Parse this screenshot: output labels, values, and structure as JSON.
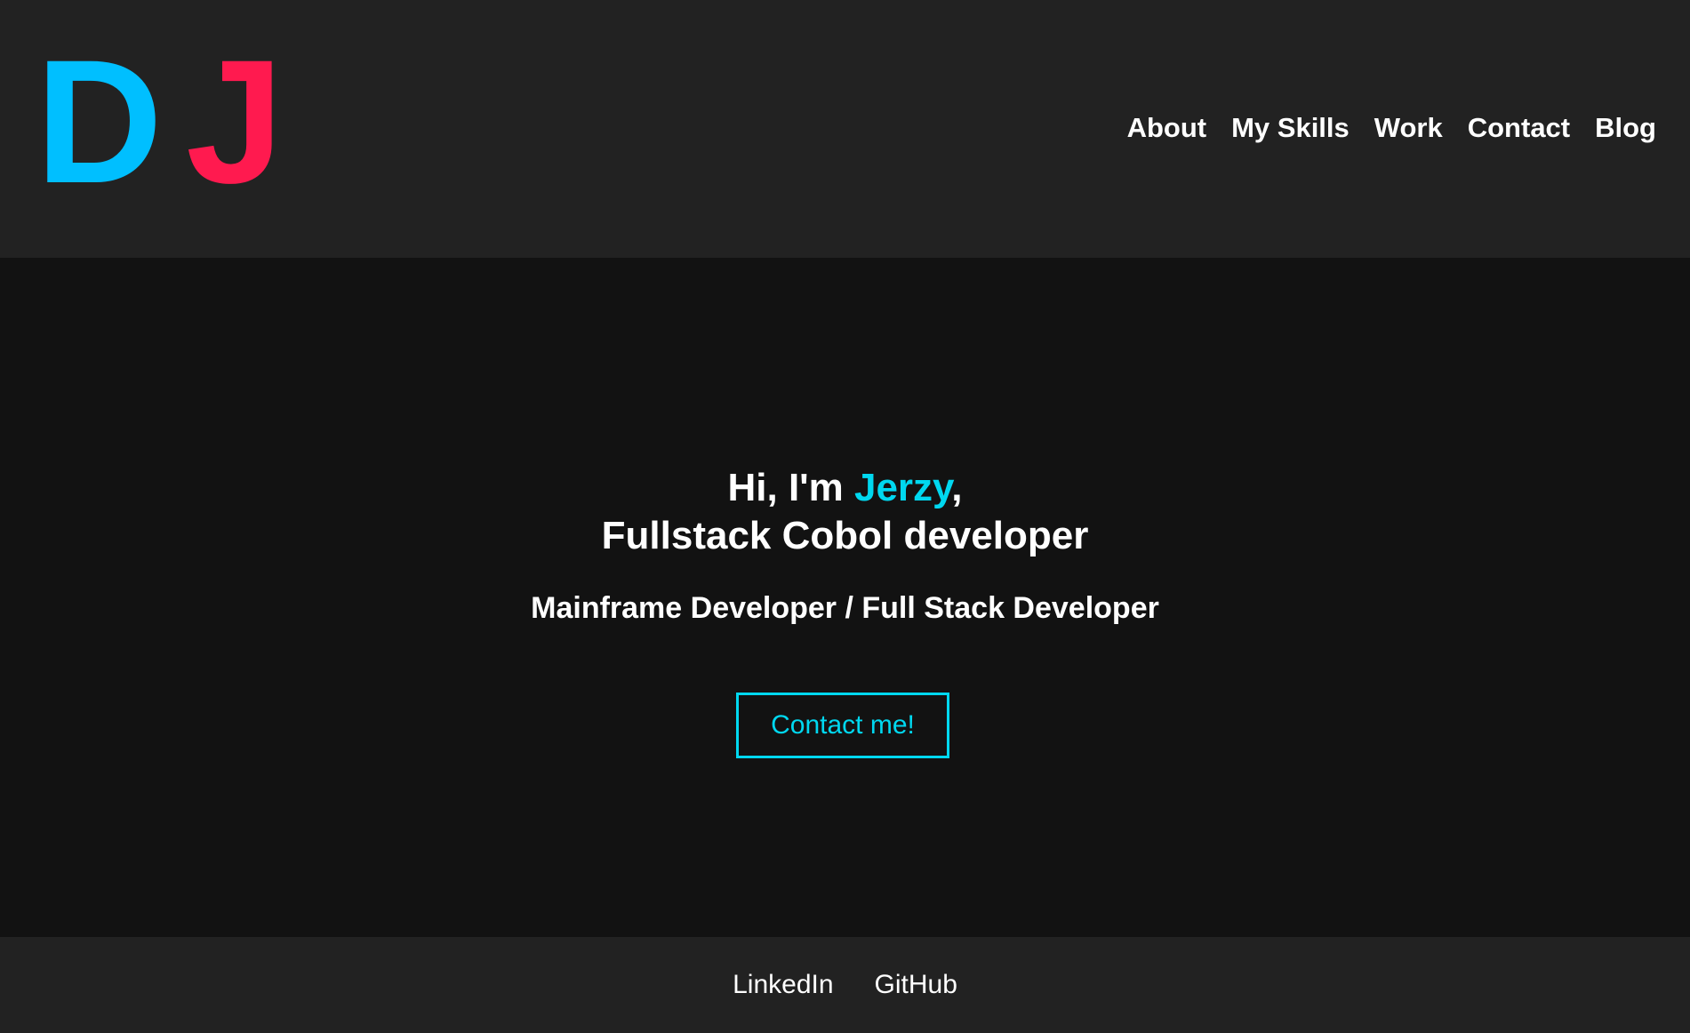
{
  "logo": {
    "first_letter": "D",
    "second_letter": "J"
  },
  "nav": {
    "items": [
      {
        "label": "About"
      },
      {
        "label": "My Skills"
      },
      {
        "label": "Work"
      },
      {
        "label": "Contact"
      },
      {
        "label": "Blog"
      }
    ]
  },
  "hero": {
    "greeting_prefix": "Hi, I'm ",
    "name": "Jerzy",
    "greeting_suffix": ",",
    "role": "Fullstack Cobol developer",
    "subtitle": "Mainframe Developer / Full Stack Developer",
    "cta_label": "Contact me!"
  },
  "footer": {
    "links": [
      {
        "label": "LinkedIn"
      },
      {
        "label": "GitHub"
      }
    ]
  },
  "colors": {
    "header_bg": "#222222",
    "page_bg": "#121212",
    "logo_d": "#00bfff",
    "logo_j": "#ff1a4f",
    "accent": "#00d8f0",
    "text": "#ffffff"
  }
}
